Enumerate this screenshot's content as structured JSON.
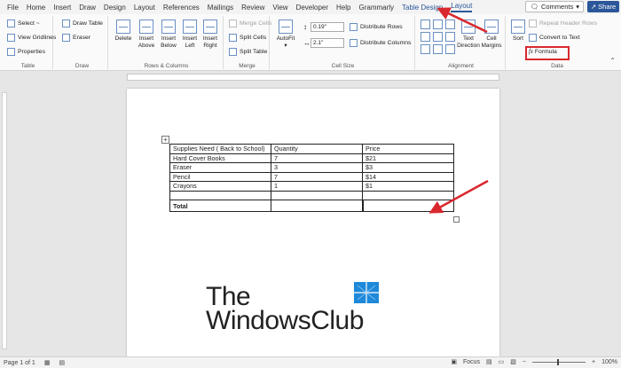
{
  "menu": {
    "tabs": [
      "File",
      "Home",
      "Insert",
      "Draw",
      "Design",
      "Layout",
      "References",
      "Mailings",
      "Review",
      "View",
      "Developer",
      "Help",
      "Grammarly"
    ],
    "table_design": "Table Design",
    "layout_active": "Layout",
    "comments": "Comments",
    "share": "Share"
  },
  "ribbon": {
    "table": {
      "select": "Select ~",
      "view_gridlines": "View Gridlines",
      "properties": "Properties",
      "label": "Table"
    },
    "draw": {
      "draw_table": "Draw Table",
      "eraser": "Eraser",
      "label": "Draw"
    },
    "rows_columns": {
      "delete": "Delete",
      "insert_above": "Insert Above",
      "insert_below": "Insert Below",
      "insert_left": "Insert Left",
      "insert_right": "Insert Right",
      "label": "Rows & Columns"
    },
    "merge": {
      "merge_cells": "Merge Cells",
      "split_cells": "Split Cells",
      "split_table": "Split Table",
      "label": "Merge"
    },
    "cell_size": {
      "autofit": "AutoFit",
      "height": "0.19\"",
      "width": "2.1\"",
      "distribute_rows": "Distribute Rows",
      "distribute_columns": "Distribute Columns",
      "label": "Cell Size"
    },
    "alignment": {
      "text_direction": "Text Direction",
      "cell_margins": "Cell Margins",
      "label": "Alignment"
    },
    "data": {
      "sort": "Sort",
      "repeat_header": "Repeat Header Rows",
      "convert": "Convert to Text",
      "formula": "Formula",
      "label": "Data"
    }
  },
  "document": {
    "table": {
      "rows": [
        [
          "Supplies Need ( Back to School)",
          "Quantity",
          "Price"
        ],
        [
          "Hard Cover Books",
          "7",
          "$21"
        ],
        [
          "Eraser",
          "3",
          "$3"
        ],
        [
          "Pencil",
          "7",
          "$14"
        ],
        [
          "Crayons",
          "1",
          "$1"
        ],
        [
          "",
          "",
          ""
        ]
      ],
      "total_label": "Total"
    },
    "watermark_line1": "The",
    "watermark_line2": "WindowsClub"
  },
  "status": {
    "page": "Page 1 of 1",
    "focus": "Focus",
    "zoom": "100%"
  },
  "colors": {
    "accent": "#2b579a",
    "annotation_red": "#d9272e"
  }
}
